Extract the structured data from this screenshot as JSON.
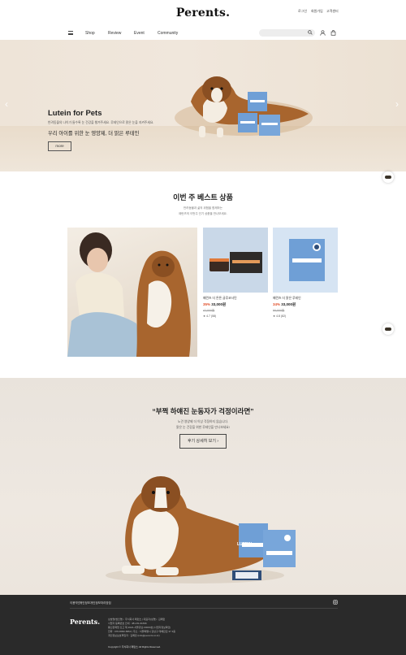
{
  "header": {
    "logo": "Perents.",
    "util_links": [
      "로그인",
      "회원가입",
      "고객센터"
    ],
    "nav": [
      "Shop",
      "Review",
      "Event",
      "Community"
    ],
    "icons": [
      "menu-icon",
      "search-icon",
      "user-icon",
      "cart-icon"
    ]
  },
  "hero": {
    "title": "Lutein for Pets",
    "subtitle": "반려동물의 나이가 들수록 눈 건강을 챙겨주세요. 루테인으로 맑은 눈을 지켜주세요.",
    "tagline": "우리 아이를 위한 눈 영양제, 더 맑은 루테인",
    "button": "more",
    "slides": 3,
    "active_slide": 1
  },
  "best": {
    "title": "이번 주 베스트 상품",
    "subtitle_1": "반려동물과 삶의 위험을 함께하는",
    "subtitle_2": "페런츠의 이번주 인기 상품을 만나보세요.",
    "products": [
      {
        "name": "페런츠 더 튼튼 글루코사민",
        "discount": "35%",
        "price": "33,000원",
        "original": "47,000원",
        "rating": "4.7 (58)",
        "accent": "#8fb0d6"
      },
      {
        "name": "페런츠 더 맑은 루테인",
        "discount": "34%",
        "price": "33,000원",
        "original": "50,000원",
        "rating": "4.8 (82)",
        "accent": "#7ea7d8"
      }
    ]
  },
  "promo": {
    "quote": "“부쩍 하얘진 눈동자가 걱정이라면”",
    "sub_1": "노견 영양제 더 이상 걱정하지 않습니다.",
    "sub_2": "맑은 눈 건강을 위한 루테인을 만나보세요!",
    "button": "후기 상세히 보기",
    "product_label": "LUTEIN"
  },
  "footer": {
    "links": [
      "이용약관",
      "개인정보",
      "개인정보처리방침"
    ],
    "logo": "Perents.",
    "info": [
      "상호명(법인명) : 주식회사 페런츠 | 대표자(성명) : 김페런",
      "사업자 등록번호 안내 : 481-81-01696",
      "통신판매업 신고 제 2024-서울강남-00000호 [사업자정보확인]",
      "전화 : 070-8090-5863 | 주소 : 서울특별시 강남구 테헤란로 37 4층",
      "개인정보보호책임자 : 김페런 (info@perents.co.kr)"
    ],
    "copyright": "Copyright © 주식회사 페런츠 All Rights Reserved."
  }
}
